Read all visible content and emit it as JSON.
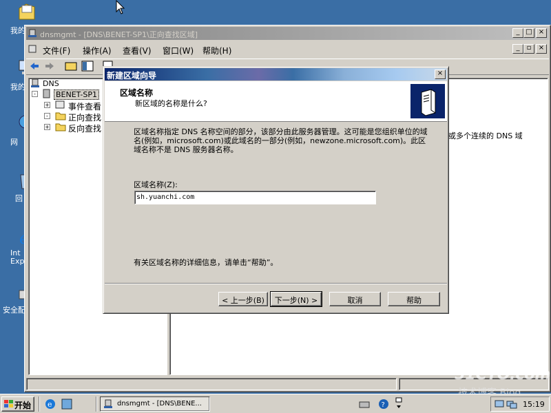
{
  "desktop": {
    "icons": [
      {
        "label": "我的"
      },
      {
        "label": "我的"
      },
      {
        "label": "网"
      },
      {
        "label": "回"
      },
      {
        "label": "Int Exp"
      },
      {
        "label": "安全配"
      }
    ]
  },
  "mmc": {
    "title": "dnsmgmt - [DNS\\BENET-SP1\\正向查找区域]",
    "menu": [
      "文件(F)",
      "操作(A)",
      "查看(V)",
      "窗口(W)",
      "帮助(H)"
    ],
    "tree": {
      "root": "DNS",
      "server": "BENET-SP1",
      "children": [
        "事件查看",
        "正向查找",
        "反向查找"
      ]
    },
    "right_text": "或多个连续的 DNS 域"
  },
  "dialog": {
    "title": "新建区域向导",
    "header_title": "区域名称",
    "header_subtitle": "新区域的名称是什么?",
    "description": "区域名称指定 DNS 名称空间的部分，该部分由此服务器管理。这可能是您组织单位的域名(例如，microsoft.com)或此域名的一部分(例如，newzone.microsoft.com)。此区域名称不是 DNS 服务器名称。",
    "field_label": "区域名称(Z):",
    "field_value": "sh.yuanchi.com",
    "help_text": "有关区域名称的详细信息，请单击“帮助”。",
    "buttons": {
      "back": "< 上一步(B)",
      "next": "下一步(N) >",
      "cancel": "取消",
      "help": "帮助"
    },
    "close": "×"
  },
  "taskbar": {
    "start": "开始",
    "task": "dnsmgmt - [DNS\\BENE...",
    "clock": "15:19"
  },
  "watermark": {
    "line1": "51CTO.com",
    "line2": "技术博客 Blog"
  }
}
